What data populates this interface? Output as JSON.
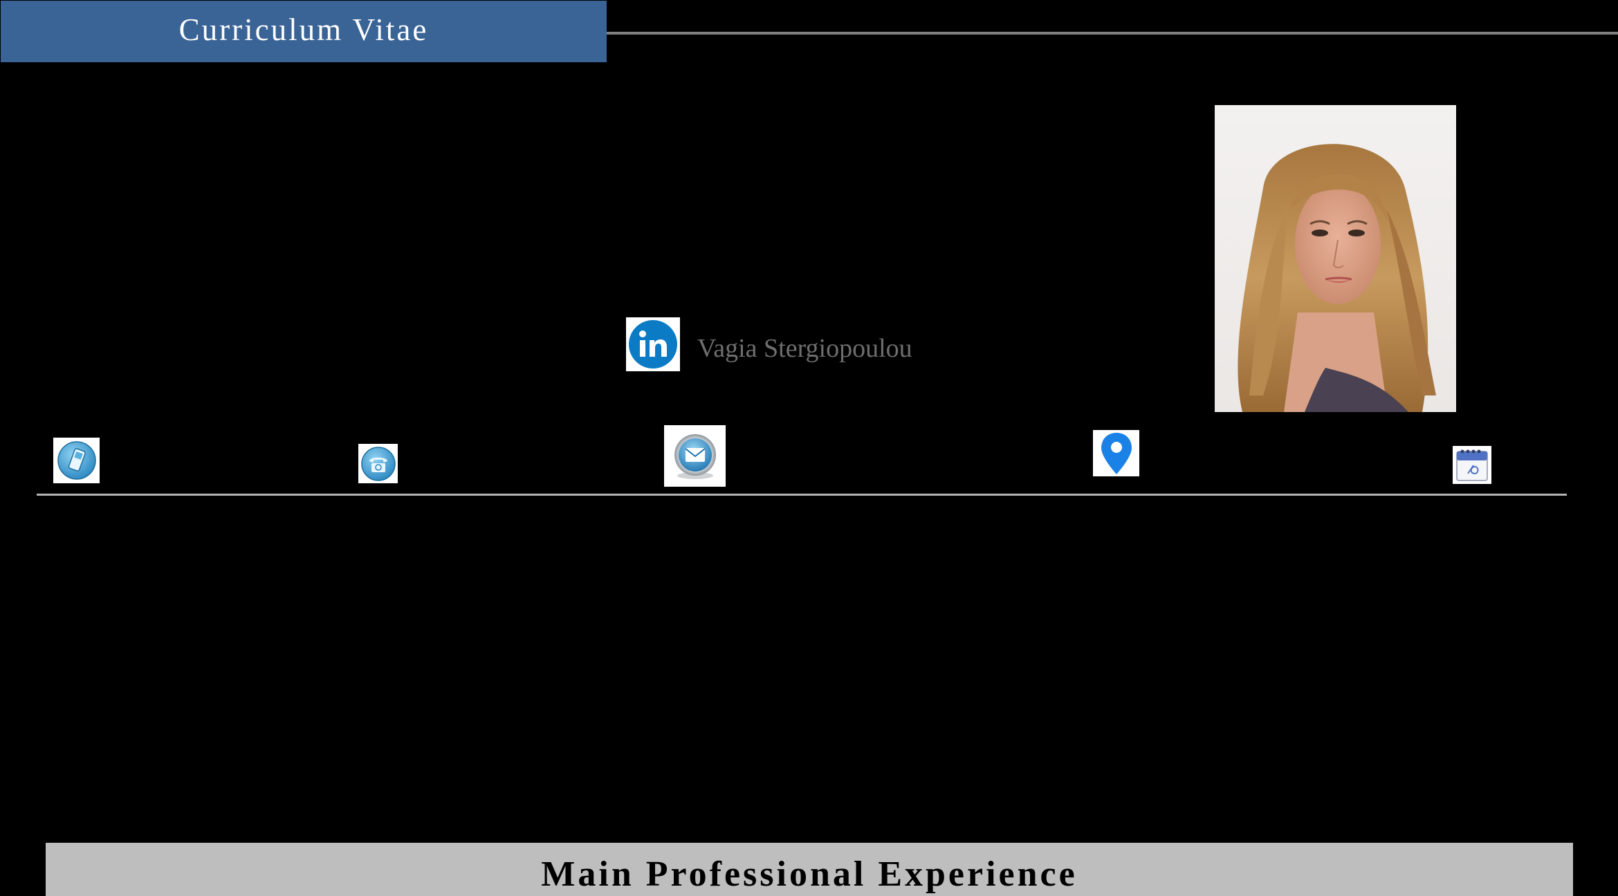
{
  "header": {
    "title": "Curriculum Vitae"
  },
  "profile": {
    "name": "Vagia Stergiopoulou",
    "photo": "portrait-photo",
    "linkedin_icon": "linkedin-icon"
  },
  "contact_icons": [
    "mobile-phone-icon",
    "telephone-icon",
    "email-icon",
    "location-pin-icon",
    "calendar-icon"
  ],
  "sections": {
    "experience_title": "Main Professional Experience"
  },
  "colors": {
    "background": "#000000",
    "banner": "#3a6496",
    "section_bar": "#bebebe",
    "accent_blue": "#0a7bc4"
  }
}
